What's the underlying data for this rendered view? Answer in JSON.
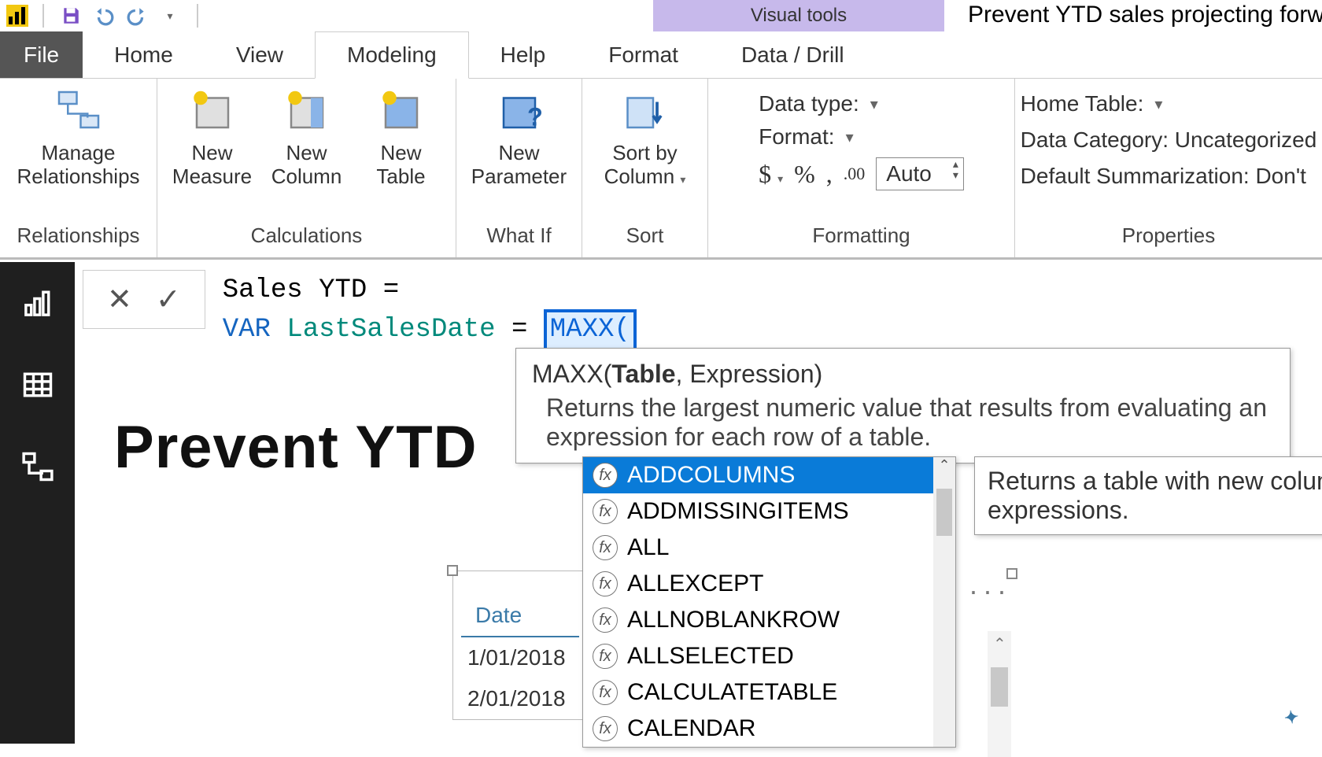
{
  "titlebar": {
    "contextual_tab": "Visual tools",
    "filename": "Prevent YTD sales projecting forwa"
  },
  "tabs": {
    "file": "File",
    "home": "Home",
    "view": "View",
    "modeling": "Modeling",
    "help": "Help",
    "format": "Format",
    "datadrill": "Data / Drill"
  },
  "ribbon": {
    "relationships": {
      "manage": "Manage\nRelationships",
      "group": "Relationships"
    },
    "calculations": {
      "measure": "New\nMeasure",
      "column": "New\nColumn",
      "table": "New\nTable",
      "group": "Calculations"
    },
    "whatif": {
      "param": "New\nParameter",
      "group": "What If"
    },
    "sort": {
      "sortby": "Sort by\nColumn",
      "group": "Sort"
    },
    "formatting": {
      "datatype": "Data type:",
      "format": "Format:",
      "currency": "$",
      "percent": "%",
      "comma": ",",
      "decimals_icon": ".00",
      "auto": "Auto",
      "group": "Formatting"
    },
    "properties": {
      "home_table": "Home Table:",
      "data_category": "Data Category: Uncategorized",
      "default_summ": "Default Summarization: Don't",
      "group": "Properties"
    }
  },
  "formula": {
    "line1_name": "Sales YTD",
    "line1_eq": " = ",
    "line2_var": "VAR",
    "line2_name": "LastSalesDate",
    "line2_eq": " = ",
    "line2_func": "MAXX("
  },
  "tooltip": {
    "sig_fn": "MAXX(",
    "sig_bold": "Table",
    "sig_rest": ", Expression)",
    "desc": "Returns the largest numeric value that results from evaluating an expression for each row of a table."
  },
  "intellisense": {
    "items": [
      "ADDCOLUMNS",
      "ADDMISSINGITEMS",
      "ALL",
      "ALLEXCEPT",
      "ALLNOBLANKROW",
      "ALLSELECTED",
      "CALCULATETABLE",
      "CALENDAR"
    ],
    "selected_desc": "Returns a table with new column expressions."
  },
  "canvas": {
    "title": "Prevent YTD",
    "date_header": "Date",
    "date_rows": [
      "1/01/2018",
      "2/01/2018"
    ]
  },
  "badge": "✦"
}
